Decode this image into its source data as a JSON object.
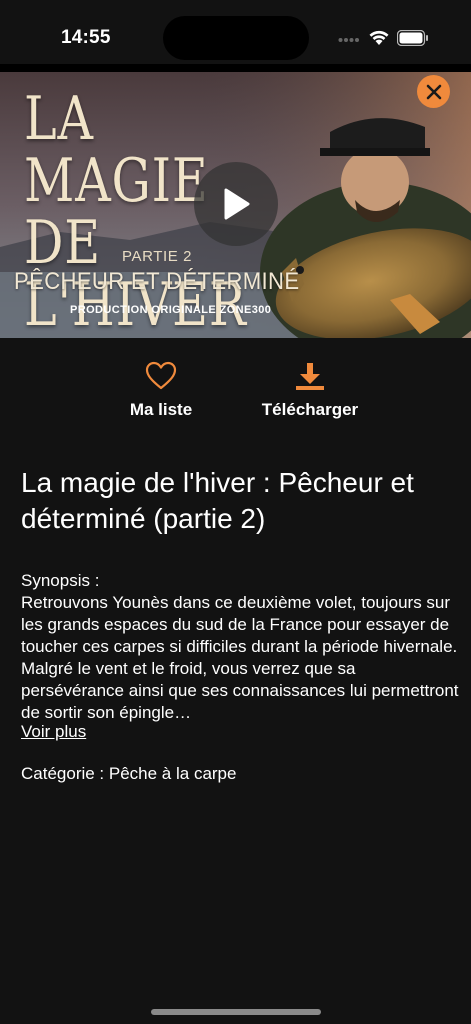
{
  "status_bar": {
    "time": "14:55",
    "icons": [
      "cellular-signal-icon",
      "wifi-icon",
      "battery-icon"
    ]
  },
  "hero": {
    "title_line1": "LA MAGIE",
    "title_line2": "DE L'HIVER",
    "part": "PARTIE 2",
    "subtitle": "PÊCHEUR ET DÉTERMINÉ",
    "production": "PRODUCTION ORIGINALE ZONE300",
    "play_icon": "play-icon",
    "close_icon": "close-icon"
  },
  "actions": {
    "my_list": {
      "label": "Ma liste",
      "icon": "heart-icon"
    },
    "download": {
      "label": "Télécharger",
      "icon": "download-icon"
    }
  },
  "content": {
    "title": "La magie de l'hiver : Pêcheur et déterminé (partie 2)",
    "synopsis_label": "Synopsis :",
    "synopsis_text": "Retrouvons Younès dans ce deuxième volet, toujours sur les grands espaces du sud de la France pour essayer de toucher ces carpes si difficiles durant la période hivernale. Malgré le vent et le froid, vous verrez que sa persévérance ainsi que ses connaissances lui permettront de sortir son épingle…",
    "see_more": "Voir plus",
    "category": "Catégorie : Pêche à la carpe"
  },
  "colors": {
    "background": "#121212",
    "accent": "#f08a3c",
    "text": "#ffffff"
  }
}
